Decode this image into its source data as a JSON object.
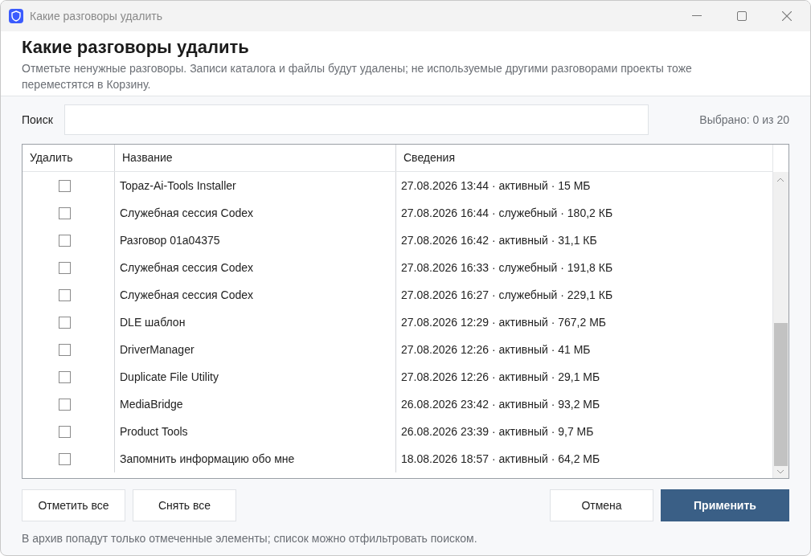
{
  "window": {
    "title": "Какие разговоры удалить"
  },
  "header": {
    "title": "Какие разговоры удалить",
    "description": "Отметьте ненужные разговоры. Записи каталога и файлы будут удалены; не используемые другими разговорами проекты тоже переместятся в Корзину."
  },
  "search": {
    "label": "Поиск",
    "counter": "Выбрано: 0 из 20"
  },
  "table": {
    "columns": [
      "Удалить",
      "Название",
      "Сведения"
    ],
    "rows": [
      {
        "checked": false,
        "name": "Topaz-Ai-Tools Installer",
        "details": "27.08.2026 13:44 · активный · 15 МБ"
      },
      {
        "checked": false,
        "name": "Служебная сессия Codex",
        "details": "27.08.2026 16:44 · служебный · 180,2 КБ"
      },
      {
        "checked": false,
        "name": "Разговор 01a04375",
        "details": "27.08.2026 16:42 · активный · 31,1 КБ"
      },
      {
        "checked": false,
        "name": "Служебная сессия Codex",
        "details": "27.08.2026 16:33 · служебный · 191,8 КБ"
      },
      {
        "checked": false,
        "name": "Служебная сессия Codex",
        "details": "27.08.2026 16:27 · служебный · 229,1 КБ"
      },
      {
        "checked": false,
        "name": "DLE шаблон",
        "details": "27.08.2026 12:29 · активный · 767,2 МБ"
      },
      {
        "checked": false,
        "name": "DriverManager",
        "details": "27.08.2026 12:26 · активный · 41 МБ"
      },
      {
        "checked": false,
        "name": "Duplicate File Utility",
        "details": "27.08.2026 12:26 · активный · 29,1 МБ"
      },
      {
        "checked": false,
        "name": "MediaBridge",
        "details": "26.08.2026 23:42 · активный · 93,2 МБ"
      },
      {
        "checked": false,
        "name": "Product Tools",
        "details": "26.08.2026 23:39 · активный · 9,7 МБ"
      },
      {
        "checked": false,
        "name": "Запомнить информацию обо мне",
        "details": "18.08.2026 18:57 · активный · 64,2 МБ"
      }
    ]
  },
  "buttons_left": [
    "Отметить все",
    "Снять все"
  ],
  "buttons_right": [
    {
      "label": "Отмена",
      "kind": "secondary"
    },
    {
      "label": "Применить",
      "kind": "primary"
    }
  ],
  "footer": "В архив попадут только отмеченные элементы; список можно отфильтровать поиском."
}
